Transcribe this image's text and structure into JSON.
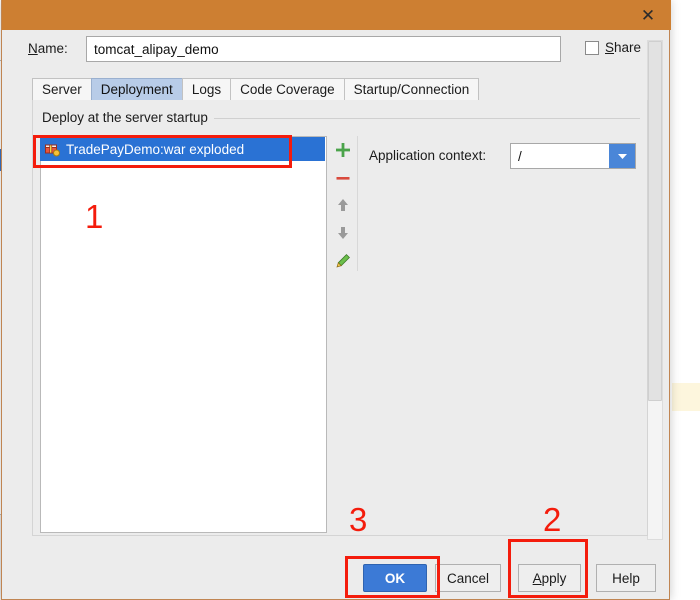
{
  "window": {
    "titlebar_color": "#cd7f32",
    "close_icon": "close-icon",
    "close_glyph": "✕"
  },
  "name_row": {
    "label_prefix": "N",
    "label_rest": "ame:",
    "value": "tomcat_alipay_demo",
    "placeholder": "",
    "share_label_prefix": "S",
    "share_label_rest": "hare",
    "share_checked": false
  },
  "tabs": [
    {
      "label": "Server",
      "active": false
    },
    {
      "label": "Deployment",
      "active": true
    },
    {
      "label": "Logs",
      "active": false
    },
    {
      "label": "Code Coverage",
      "active": false
    },
    {
      "label": "Startup/Connection",
      "active": false
    }
  ],
  "group": {
    "title": "Deploy at the server startup"
  },
  "deployment_list": {
    "items": [
      {
        "icon": "war-artifact-icon",
        "label": "TradePayDemo:war exploded",
        "selected": true
      }
    ]
  },
  "side_toolbar": {
    "buttons": [
      {
        "name": "add-button",
        "glyph": "＋",
        "color": "#4aa34a"
      },
      {
        "name": "remove-button",
        "glyph": "—",
        "color": "#d94a3d"
      },
      {
        "name": "move-up-button",
        "glyph": "⬆",
        "color": "#9a9a9a"
      },
      {
        "name": "move-down-button",
        "glyph": "⬇",
        "color": "#9a9a9a"
      },
      {
        "name": "edit-button",
        "glyph": "✎",
        "color": "#6cbf4b"
      }
    ]
  },
  "application_context": {
    "label": "Application context:",
    "value": "/",
    "dropdown_icon": "chevron-down-icon",
    "dropdown_glyph": "▼",
    "dropdown_color": "#4a86d8"
  },
  "buttons": {
    "ok": "OK",
    "cancel": "Cancel",
    "apply_prefix": "A",
    "apply_rest": "pply",
    "help": "Help"
  },
  "annotations": {
    "color": "#f41c0c",
    "numbers": {
      "one": "1",
      "two": "2",
      "three": "3"
    }
  }
}
